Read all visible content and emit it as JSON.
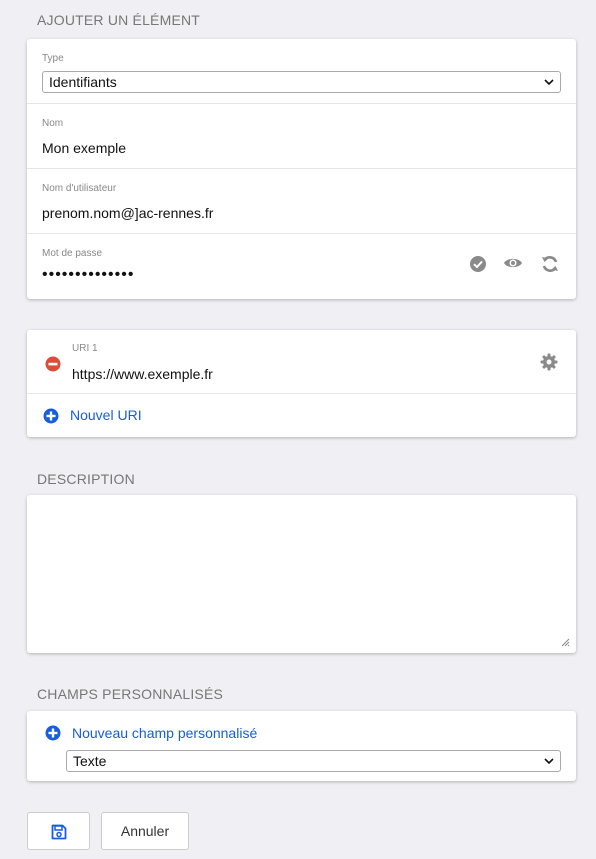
{
  "add_item": {
    "section_title": "AJOUTER UN ÉLÉMENT",
    "type_label": "Type",
    "type_value": "Identifiants",
    "name_label": "Nom",
    "name_value": "Mon exemple",
    "username_label": "Nom d'utilisateur",
    "username_value": "prenom.nom@]ac-rennes.fr",
    "password_label": "Mot de passe",
    "password_value": "••••••••••••••"
  },
  "uris": {
    "uri_label": "URI 1",
    "uri_value": "https://www.exemple.fr",
    "new_uri_label": "Nouvel URI"
  },
  "description": {
    "section_title": "DESCRIPTION",
    "value": ""
  },
  "custom_fields": {
    "section_title": "CHAMPS PERSONNALISÉS",
    "new_field_label": "Nouveau champ personnalisé",
    "field_type_value": "Texte"
  },
  "footer": {
    "cancel_label": "Annuler"
  },
  "colors": {
    "accent": "#175ddc",
    "danger": "#dd4b39",
    "icon_gray": "#8a8a8a",
    "background": "#efeff4"
  }
}
